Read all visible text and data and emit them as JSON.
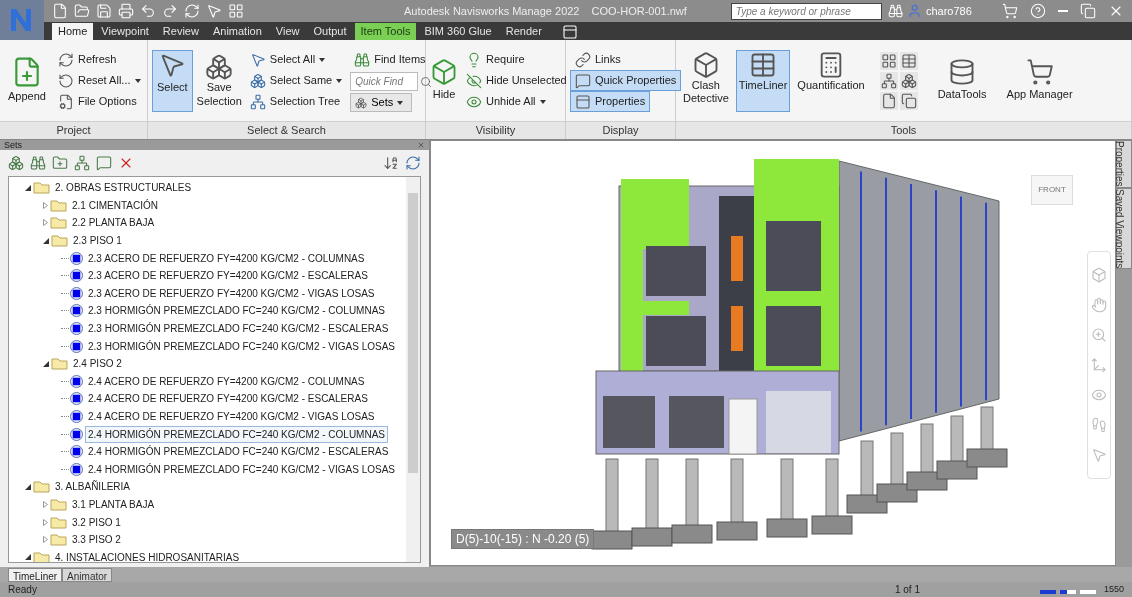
{
  "window": {
    "app_title": "Autodesk Navisworks Manage 2022",
    "file_name": "COO-HOR-001.nwf",
    "search": {
      "placeholder": "Type a keyword or phrase"
    },
    "user": "charo786"
  },
  "tabs": [
    {
      "label": "Home",
      "selected": true,
      "kind": "normal"
    },
    {
      "label": "Viewpoint",
      "selected": false,
      "kind": "normal"
    },
    {
      "label": "Review",
      "selected": false,
      "kind": "normal"
    },
    {
      "label": "Animation",
      "selected": false,
      "kind": "normal"
    },
    {
      "label": "View",
      "selected": false,
      "kind": "normal"
    },
    {
      "label": "Output",
      "selected": false,
      "kind": "normal"
    },
    {
      "label": "Item Tools",
      "selected": false,
      "kind": "contextual"
    },
    {
      "label": "BIM 360 Glue",
      "selected": false,
      "kind": "normal"
    },
    {
      "label": "Render",
      "selected": false,
      "kind": "normal"
    }
  ],
  "ribbon": {
    "project": {
      "label": "Project",
      "append": "Append",
      "small": [
        "Refresh",
        "Reset All...",
        "File Options"
      ]
    },
    "select_search": {
      "label": "Select & Search",
      "select": {
        "label": "Select",
        "selected": true
      },
      "save_selection": "Save Selection",
      "small": [
        "Select All",
        "Select Same",
        "Selection Tree"
      ],
      "find_items": "Find Items",
      "quick_find": {
        "placeholder": "Quick Find"
      },
      "sets": "Sets"
    },
    "visibility": {
      "label": "Visibility",
      "hide": "Hide",
      "small": [
        "Require",
        "Hide Unselected",
        "Unhide All"
      ]
    },
    "display": {
      "label": "Display",
      "items": [
        {
          "label": "Links",
          "selected": false
        },
        {
          "label": "Quick Properties",
          "selected": true
        },
        {
          "label": "Properties",
          "selected": true
        }
      ]
    },
    "tools": {
      "label": "Tools",
      "items": [
        {
          "label": "Clash Detective",
          "selected": false
        },
        {
          "label": "TimeLiner",
          "selected": true
        },
        {
          "label": "Quantification",
          "selected": false
        }
      ],
      "data_tools": "DataTools",
      "app_manager": "App Manager"
    }
  },
  "sets_panel": {
    "title": "Sets",
    "tree": [
      {
        "label": "2. OBRAS ESTRUCTURALES",
        "kind": "folder",
        "expanded": true,
        "selected": false,
        "children": [
          {
            "label": "2.1 CIMENTACIÓN",
            "kind": "folder",
            "expanded": false,
            "selected": false
          },
          {
            "label": "2.2 PLANTA BAJA",
            "kind": "folder",
            "expanded": false,
            "selected": false
          },
          {
            "label": "2.3 PISO 1",
            "kind": "folder",
            "expanded": true,
            "selected": false,
            "children": [
              {
                "label": "2.3 ACERO DE REFUERZO FY=4200 KG/CM2 - COLUMNAS",
                "kind": "set",
                "selected": false
              },
              {
                "label": "2.3 ACERO DE REFUERZO FY=4200 KG/CM2 - ESCALERAS",
                "kind": "set",
                "selected": false
              },
              {
                "label": "2.3 ACERO DE REFUERZO FY=4200 KG/CM2 - VIGAS LOSAS",
                "kind": "set",
                "selected": false
              },
              {
                "label": "2.3 HORMIGÓN PREMEZCLADO FC=240 KG/CM2 - COLUMNAS",
                "kind": "set",
                "selected": false
              },
              {
                "label": "2.3 HORMIGÓN PREMEZCLADO FC=240 KG/CM2 - ESCALERAS",
                "kind": "set",
                "selected": false
              },
              {
                "label": "2.3 HORMIGÓN PREMEZCLADO FC=240 KG/CM2 - VIGAS LOSAS",
                "kind": "set",
                "selected": false
              }
            ]
          },
          {
            "label": "2.4 PISO 2",
            "kind": "folder",
            "expanded": true,
            "selected": false,
            "children": [
              {
                "label": "2.4 ACERO DE REFUERZO FY=4200 KG/CM2 - COLUMNAS",
                "kind": "set",
                "selected": false
              },
              {
                "label": "2.4 ACERO DE REFUERZO FY=4200 KG/CM2 - ESCALERAS",
                "kind": "set",
                "selected": false
              },
              {
                "label": "2.4 ACERO DE REFUERZO FY=4200 KG/CM2 - VIGAS LOSAS",
                "kind": "set",
                "selected": false
              },
              {
                "label": "2.4 HORMIGÓN PREMEZCLADO FC=240 KG/CM2 - COLUMNAS",
                "kind": "set",
                "selected": true
              },
              {
                "label": "2.4 HORMIGÓN PREMEZCLADO FC=240 KG/CM2 - ESCALERAS",
                "kind": "set",
                "selected": false
              },
              {
                "label": "2.4 HORMIGÓN PREMEZCLADO FC=240 KG/CM2 - VIGAS LOSAS",
                "kind": "set",
                "selected": false
              }
            ]
          }
        ]
      },
      {
        "label": "3. ALBAÑILERIA",
        "kind": "folder",
        "expanded": true,
        "selected": false,
        "children": [
          {
            "label": "3.1 PLANTA BAJA",
            "kind": "folder",
            "expanded": false,
            "selected": false
          },
          {
            "label": "3.2 PISO 1",
            "kind": "folder",
            "expanded": false,
            "selected": false
          },
          {
            "label": "3.3 PISO 2",
            "kind": "folder",
            "expanded": false,
            "selected": false
          }
        ]
      },
      {
        "label": "4. INSTALACIONES HIDROSANITARIAS",
        "kind": "folder",
        "expanded": true,
        "selected": false
      }
    ]
  },
  "viewport": {
    "view_cube": "FRONT",
    "coordinates": "D(5)-10(-15) : N -0.20 (5)"
  },
  "side_tabs": [
    "Properties",
    "Saved Viewpoints"
  ],
  "bottom_tabs": [
    {
      "label": "TimeLiner",
      "selected": true
    },
    {
      "label": "Animator",
      "selected": false
    }
  ],
  "status_bar": {
    "status": "Ready",
    "page": "1 of 1",
    "number": "1550"
  }
}
